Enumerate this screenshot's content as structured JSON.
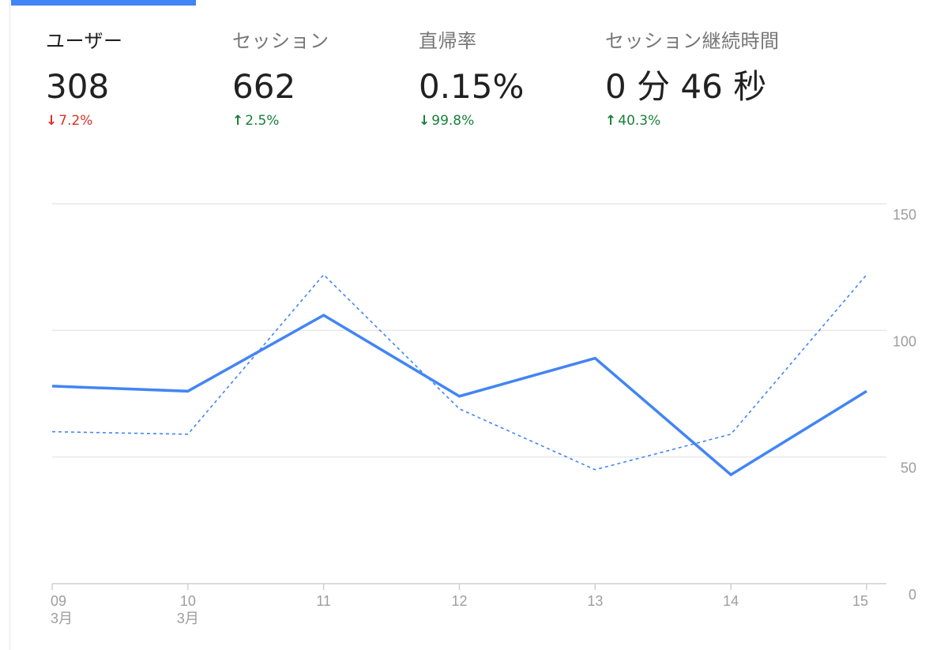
{
  "metrics": [
    {
      "label": "ユーザー",
      "value": "308",
      "change": "7.2%",
      "direction": "down",
      "status": "negative",
      "active": true
    },
    {
      "label": "セッション",
      "value": "662",
      "change": "2.5%",
      "direction": "up",
      "status": "positive",
      "active": false
    },
    {
      "label": "直帰率",
      "value": "0.15%",
      "change": "99.8%",
      "direction": "down",
      "status": "positive",
      "active": false
    },
    {
      "label": "セッション継続時間",
      "value": "0 分 46 秒",
      "change": "40.3%",
      "direction": "up",
      "status": "positive",
      "active": false
    }
  ],
  "icons": {
    "up": "arrow-up-icon",
    "down": "arrow-down-icon"
  },
  "colors": {
    "accent": "#4285f4",
    "negative": "#d93025",
    "positive": "#188038"
  },
  "chart_data": {
    "type": "line",
    "x": [
      "09",
      "10",
      "11",
      "12",
      "13",
      "14",
      "15"
    ],
    "x_sublabels": [
      "3月",
      "3月",
      "",
      "",
      "",
      "",
      ""
    ],
    "series": [
      {
        "values": [
          78,
          76,
          106,
          74,
          89,
          43,
          76
        ],
        "style": "solid",
        "color": "#4285f4"
      },
      {
        "values": [
          60,
          59,
          122,
          69,
          45,
          59,
          122
        ],
        "style": "dashed",
        "color": "#4285f4"
      }
    ],
    "yticks": [
      0,
      50,
      100,
      150
    ],
    "ylim": [
      0,
      150
    ],
    "y_axis_position": "right",
    "grid": true
  }
}
